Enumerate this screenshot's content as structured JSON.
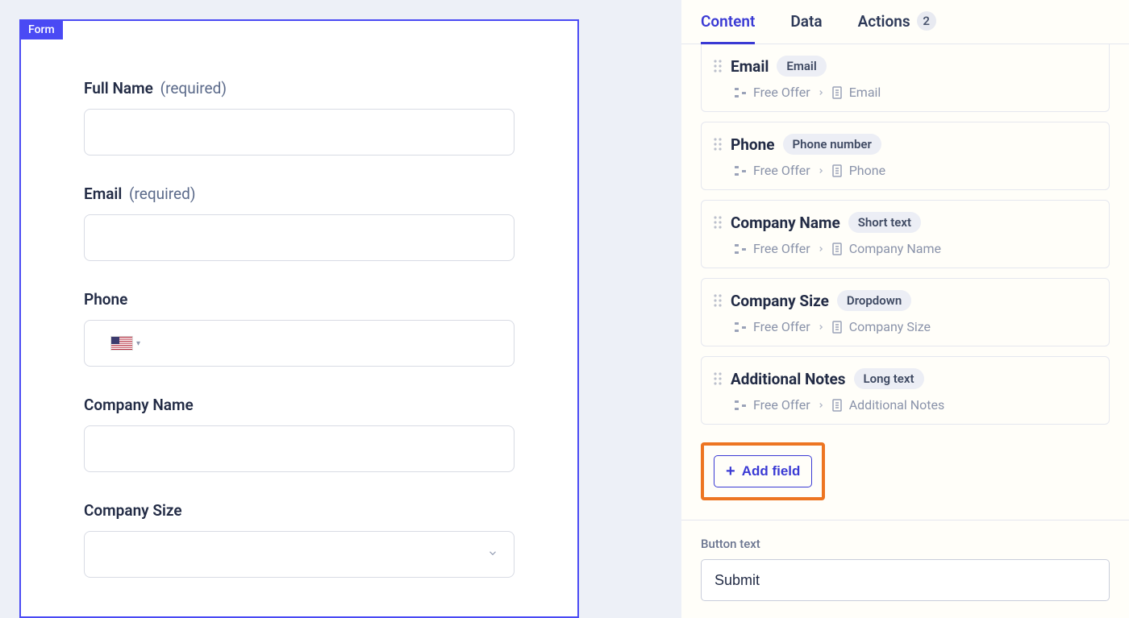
{
  "form_tag": "Form",
  "form_fields": {
    "full_name": {
      "label": "Full Name",
      "required_text": "(required)"
    },
    "email": {
      "label": "Email",
      "required_text": "(required)"
    },
    "phone": {
      "label": "Phone"
    },
    "company_name": {
      "label": "Company Name"
    },
    "company_size": {
      "label": "Company Size"
    }
  },
  "tabs": {
    "content": "Content",
    "data": "Data",
    "actions": "Actions",
    "actions_count": "2"
  },
  "field_cards": [
    {
      "name": "Email",
      "type": "Email",
      "path_root": "Free Offer",
      "path_leaf": "Email"
    },
    {
      "name": "Phone",
      "type": "Phone number",
      "path_root": "Free Offer",
      "path_leaf": "Phone"
    },
    {
      "name": "Company Name",
      "type": "Short text",
      "path_root": "Free Offer",
      "path_leaf": "Company Name"
    },
    {
      "name": "Company Size",
      "type": "Dropdown",
      "path_root": "Free Offer",
      "path_leaf": "Company Size"
    },
    {
      "name": "Additional Notes",
      "type": "Long text",
      "path_root": "Free Offer",
      "path_leaf": "Additional Notes"
    }
  ],
  "add_field_label": "Add field",
  "button_text_section": {
    "label": "Button text",
    "value": "Submit"
  }
}
